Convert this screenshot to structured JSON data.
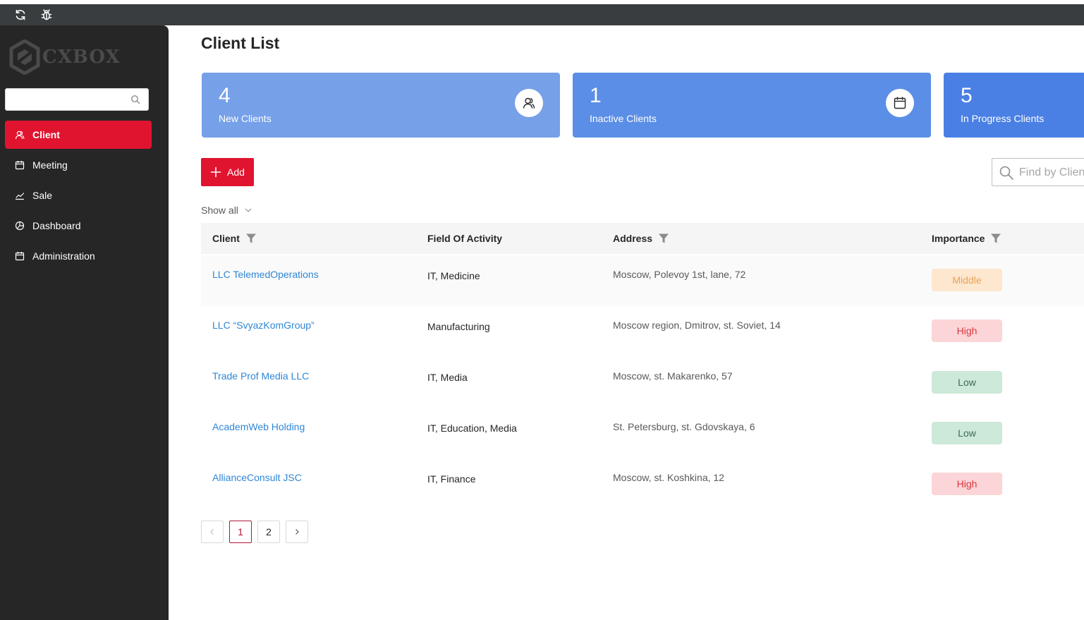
{
  "topbar": {
    "icons": [
      "refresh-icon",
      "bug-icon"
    ]
  },
  "sidebar": {
    "logo_text": "CXBOX",
    "search": {
      "value": "",
      "placeholder": ""
    },
    "items": [
      {
        "label": "Client",
        "icon": "users-icon",
        "active": true
      },
      {
        "label": "Meeting",
        "icon": "calendar-icon",
        "active": false
      },
      {
        "label": "Sale",
        "icon": "line-chart-icon",
        "active": false
      },
      {
        "label": "Dashboard",
        "icon": "pie-chart-icon",
        "active": false
      },
      {
        "label": "Administration",
        "icon": "calendar-icon",
        "active": false
      }
    ]
  },
  "main": {
    "title": "Client List",
    "cards": [
      {
        "number": "4",
        "label": "New Clients",
        "icon": "users-icon",
        "color": "#76a0e8"
      },
      {
        "number": "1",
        "label": "Inactive Clients",
        "icon": "calendar-icon",
        "color": "#5b8ee6"
      },
      {
        "number": "5",
        "label": "In Progress Clients",
        "icon": "",
        "color": "#4a80e4"
      }
    ],
    "add_button": "Add",
    "find": {
      "placeholder": "Find by Client",
      "value": ""
    },
    "show_all": "Show all",
    "table": {
      "columns": [
        "Client",
        "Field Of Activity",
        "Address",
        "Importance"
      ],
      "rows": [
        {
          "client": "LLC TelemedOperations",
          "field": "IT, Medicine",
          "address": "Moscow, Polevoy 1st, lane, 72",
          "importance": "Middle"
        },
        {
          "client": "LLC “SvyazKomGroup”",
          "field": "Manufacturing",
          "address": "Moscow region, Dmitrov, st. Soviet, 14",
          "importance": "High"
        },
        {
          "client": "Trade Prof Media LLC",
          "field": "IT, Media",
          "address": "Moscow, st. Makarenko, 57",
          "importance": "Low"
        },
        {
          "client": "AcademWeb Holding",
          "field": "IT, Education, Media",
          "address": "St. Petersburg, st. Gdovskaya, 6",
          "importance": "Low"
        },
        {
          "client": "AllianceConsult JSC",
          "field": "IT, Finance",
          "address": "Moscow, st. Koshkina, 12",
          "importance": "High"
        }
      ]
    },
    "pagination": {
      "pages": [
        "1",
        "2"
      ],
      "current": "1"
    }
  },
  "colors": {
    "accent": "#e0142f",
    "link": "#2f86d6",
    "badge_middle": {
      "bg": "#fde7cf",
      "fg": "#e8a25a"
    },
    "badge_high": {
      "bg": "#fbd5d7",
      "fg": "#d9363e"
    },
    "badge_low": {
      "bg": "#cde9d9",
      "fg": "#3d6b52"
    }
  }
}
